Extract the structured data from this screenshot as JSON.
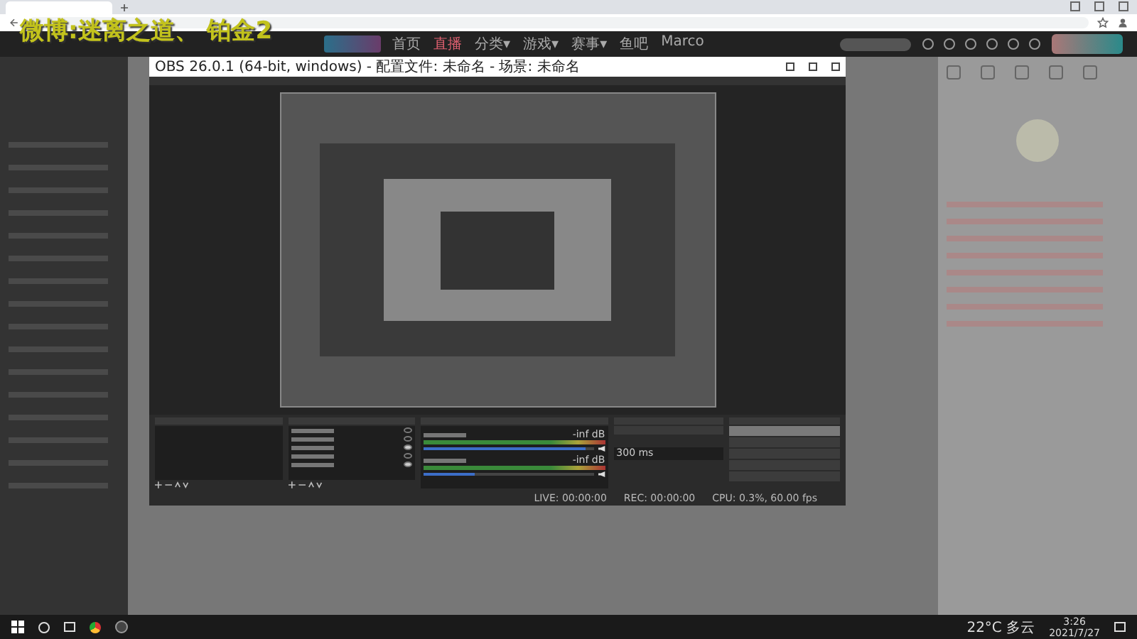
{
  "overlay_text": "微博:迷离之道、 铂金2",
  "site_nav": [
    {
      "label": "首页",
      "selected": false
    },
    {
      "label": "直播",
      "selected": true
    },
    {
      "label": "分类▾",
      "selected": false
    },
    {
      "label": "游戏▾",
      "selected": false
    },
    {
      "label": "赛事▾",
      "selected": false
    },
    {
      "label": "鱼吧",
      "selected": false
    },
    {
      "label": "Marco",
      "selected": false
    }
  ],
  "obs": {
    "title": "OBS 26.0.1 (64-bit, windows) - 配置文件: 未命名 - 场景: 未命名",
    "sources": [
      {
        "visible": false
      },
      {
        "visible": false
      },
      {
        "visible": true
      },
      {
        "visible": false
      },
      {
        "visible": true
      }
    ],
    "mixer": [
      {
        "reading": "-inf dB",
        "level": 0.95
      },
      {
        "reading": "-inf dB",
        "level": 0.3
      }
    ],
    "duration": "300 ms",
    "controls": [
      {
        "selected": true
      },
      {
        "selected": false
      },
      {
        "selected": false
      },
      {
        "selected": false
      },
      {
        "selected": false
      }
    ],
    "status": [
      "LIVE: 00:00:00",
      "REC: 00:00:00",
      "CPU: 0.3%, 60.00 fps"
    ]
  },
  "taskbar": {
    "weather": "22°C 多云",
    "time": "3:26",
    "date": "2021/7/27"
  }
}
